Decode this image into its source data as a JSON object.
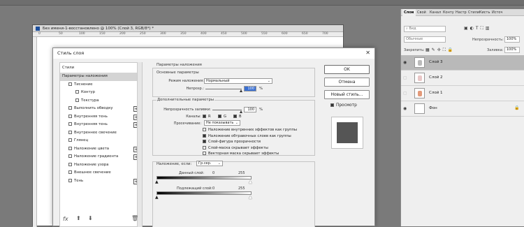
{
  "document": {
    "title": "Без имени-1-восстановлено @ 100% (Слой 3, RGB/8*) *",
    "ruler_ticks": [
      "0",
      "50",
      "100",
      "150",
      "200",
      "250",
      "300",
      "350",
      "400",
      "450",
      "500",
      "550",
      "600",
      "650",
      "700"
    ]
  },
  "layers_panel": {
    "tabs": [
      "Слои",
      "Свой",
      "Канал",
      "Конту",
      "Настр",
      "Стили",
      "Кисть",
      "Источ"
    ],
    "search_placeholder": "Вид",
    "blend_mode": "Обычные",
    "opacity_label": "Непрозрачность:",
    "opacity_value": "100%",
    "lock_label": "Закрепить:",
    "fill_label": "Заливка:",
    "fill_value": "100%",
    "layers": [
      {
        "name": "Слой 3",
        "selected": true
      },
      {
        "name": "Слой 2",
        "selected": false
      },
      {
        "name": "Слой 1",
        "selected": false
      },
      {
        "name": "Фон",
        "selected": false
      }
    ]
  },
  "dialog": {
    "title": "Стиль слоя",
    "styles_header": "Стили",
    "style_items": [
      {
        "label": "Параметры наложения",
        "type": "selected",
        "plus": false
      },
      {
        "label": "Тиснение",
        "type": "check",
        "plus": false
      },
      {
        "label": "Контур",
        "type": "subcheck",
        "plus": false
      },
      {
        "label": "Текстура",
        "type": "subcheck",
        "plus": false
      },
      {
        "label": "Выполнить обводку",
        "type": "check",
        "plus": true
      },
      {
        "label": "Внутренняя тень",
        "type": "check",
        "plus": true
      },
      {
        "label": "Внутренняя тень",
        "type": "check",
        "plus": true
      },
      {
        "label": "Внутреннее свечение",
        "type": "check",
        "plus": false
      },
      {
        "label": "Глянец",
        "type": "check",
        "plus": false
      },
      {
        "label": "Наложение цвета",
        "type": "check",
        "plus": true
      },
      {
        "label": "Наложение градиента",
        "type": "check",
        "plus": true
      },
      {
        "label": "Наложение узора",
        "type": "check",
        "plus": false
      },
      {
        "label": "Внешнее свечение",
        "type": "check",
        "plus": false
      },
      {
        "label": "Тень",
        "type": "check",
        "plus": true
      }
    ],
    "footer_fx": "fx",
    "blend_options": {
      "section_title": "Параметры наложения",
      "general_title": "Основные параметры",
      "blend_mode_label": "Режим наложения:",
      "blend_mode_value": "Нормальный",
      "opacity_label": "Непрозр.:",
      "opacity_value": "100",
      "opacity_unit": "%"
    },
    "advanced": {
      "title": "Дополнительные параметры",
      "fill_label": "Непрозрачность заливки:",
      "fill_value": "100",
      "fill_unit": "%",
      "channels_label": "Каналы:",
      "channels": [
        "R",
        "G",
        "B"
      ],
      "knockout_label": "Просечивание:",
      "knockout_value": "Не показывать",
      "options": [
        {
          "label": "Наложение внутренних эффектов как группы",
          "checked": false
        },
        {
          "label": "Наложение обтравочных слоев как группы",
          "checked": true
        },
        {
          "label": "Слой-фигура прозрачности",
          "checked": true
        },
        {
          "label": "Слой-маска скрывает эффекты",
          "checked": false
        },
        {
          "label": "Векторная маска скрывает эффекты",
          "checked": false
        }
      ]
    },
    "blend_if": {
      "label": "Наложение, если:",
      "value": "Гр.сер.",
      "this_layer_label": "Данный слой:",
      "this_layer_min": "0",
      "this_layer_max": "255",
      "underlying_label": "Подлежащий слой:",
      "underlying_min": "0",
      "underlying_max": "255"
    },
    "buttons": {
      "ok": "OK",
      "cancel": "Отмена",
      "new_style": "Новый стиль...",
      "preview": "Просмотр"
    }
  }
}
